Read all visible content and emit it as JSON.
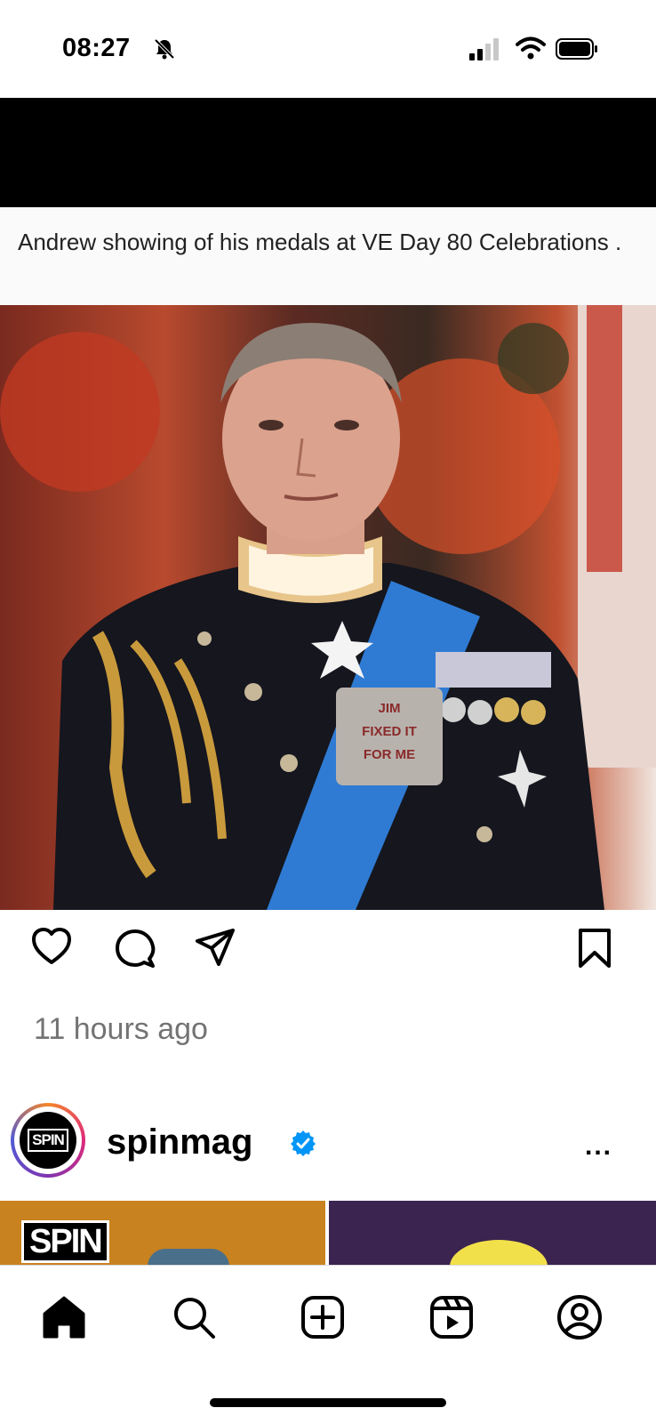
{
  "status_bar": {
    "time": "08:27",
    "icons": [
      "bell-slash-icon",
      "cellular-signal-icon",
      "wifi-icon",
      "battery-icon"
    ]
  },
  "post": {
    "caption": "Andrew showing of his medals at VE Day 80 Celebrations .",
    "badge_text": "JIM FIXED IT FOR ME",
    "timestamp": "11 hours ago",
    "actions": [
      "heart-icon",
      "comment-icon",
      "share-icon",
      "bookmark-icon"
    ]
  },
  "next_post": {
    "avatar_text": "SPIN",
    "username": "spinmag",
    "verified": true,
    "more_label": "...",
    "preview_logo": "SPIN"
  },
  "tabbar": {
    "items": [
      "home-icon",
      "search-icon",
      "create-icon",
      "reels-icon",
      "profile-icon"
    ],
    "active": "home-icon"
  },
  "colors": {
    "timestamp": "#737373",
    "verified": "#0095f6",
    "text": "#000000"
  }
}
